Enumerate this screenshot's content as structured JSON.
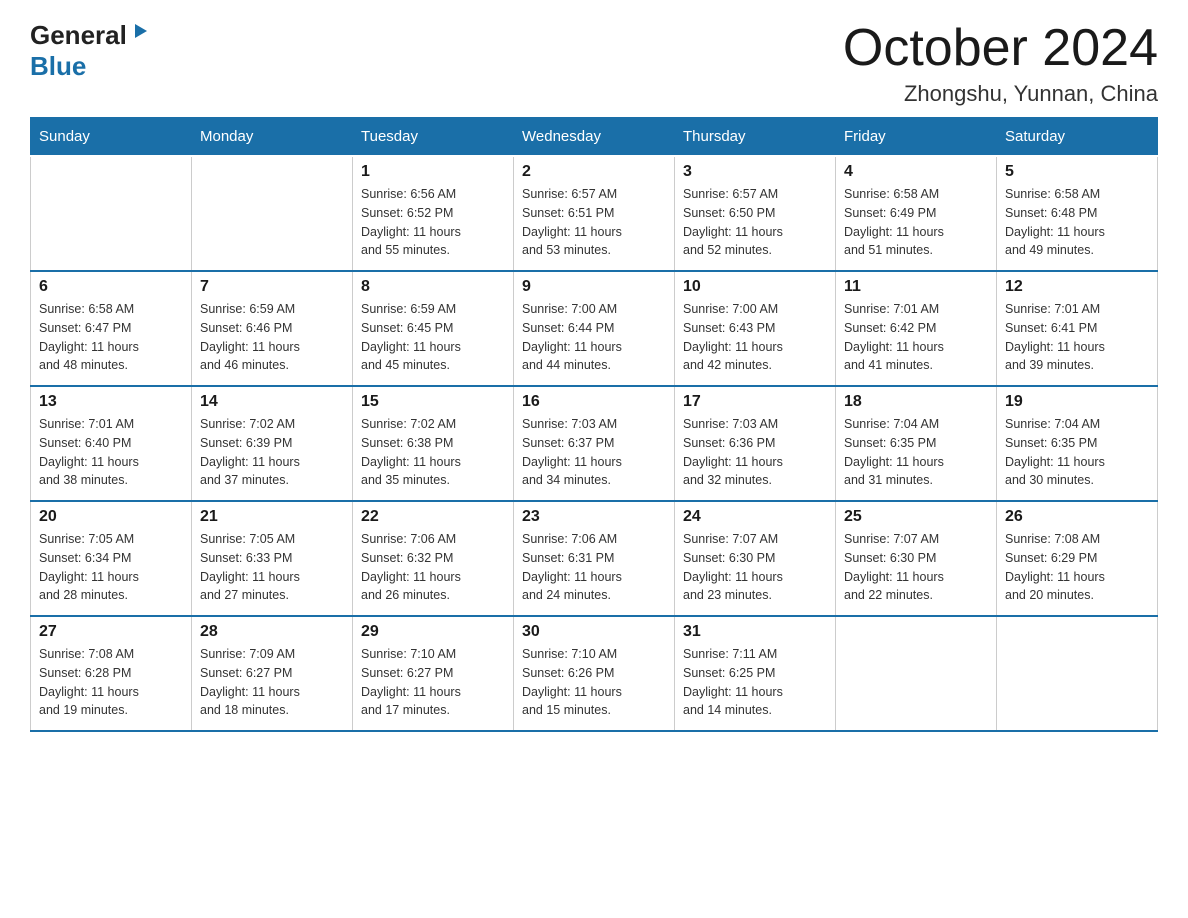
{
  "logo": {
    "general": "General",
    "blue": "Blue"
  },
  "title": {
    "month": "October 2024",
    "location": "Zhongshu, Yunnan, China"
  },
  "days_header": [
    "Sunday",
    "Monday",
    "Tuesday",
    "Wednesday",
    "Thursday",
    "Friday",
    "Saturday"
  ],
  "weeks": [
    [
      {
        "day": "",
        "info": ""
      },
      {
        "day": "",
        "info": ""
      },
      {
        "day": "1",
        "info": "Sunrise: 6:56 AM\nSunset: 6:52 PM\nDaylight: 11 hours\nand 55 minutes."
      },
      {
        "day": "2",
        "info": "Sunrise: 6:57 AM\nSunset: 6:51 PM\nDaylight: 11 hours\nand 53 minutes."
      },
      {
        "day": "3",
        "info": "Sunrise: 6:57 AM\nSunset: 6:50 PM\nDaylight: 11 hours\nand 52 minutes."
      },
      {
        "day": "4",
        "info": "Sunrise: 6:58 AM\nSunset: 6:49 PM\nDaylight: 11 hours\nand 51 minutes."
      },
      {
        "day": "5",
        "info": "Sunrise: 6:58 AM\nSunset: 6:48 PM\nDaylight: 11 hours\nand 49 minutes."
      }
    ],
    [
      {
        "day": "6",
        "info": "Sunrise: 6:58 AM\nSunset: 6:47 PM\nDaylight: 11 hours\nand 48 minutes."
      },
      {
        "day": "7",
        "info": "Sunrise: 6:59 AM\nSunset: 6:46 PM\nDaylight: 11 hours\nand 46 minutes."
      },
      {
        "day": "8",
        "info": "Sunrise: 6:59 AM\nSunset: 6:45 PM\nDaylight: 11 hours\nand 45 minutes."
      },
      {
        "day": "9",
        "info": "Sunrise: 7:00 AM\nSunset: 6:44 PM\nDaylight: 11 hours\nand 44 minutes."
      },
      {
        "day": "10",
        "info": "Sunrise: 7:00 AM\nSunset: 6:43 PM\nDaylight: 11 hours\nand 42 minutes."
      },
      {
        "day": "11",
        "info": "Sunrise: 7:01 AM\nSunset: 6:42 PM\nDaylight: 11 hours\nand 41 minutes."
      },
      {
        "day": "12",
        "info": "Sunrise: 7:01 AM\nSunset: 6:41 PM\nDaylight: 11 hours\nand 39 minutes."
      }
    ],
    [
      {
        "day": "13",
        "info": "Sunrise: 7:01 AM\nSunset: 6:40 PM\nDaylight: 11 hours\nand 38 minutes."
      },
      {
        "day": "14",
        "info": "Sunrise: 7:02 AM\nSunset: 6:39 PM\nDaylight: 11 hours\nand 37 minutes."
      },
      {
        "day": "15",
        "info": "Sunrise: 7:02 AM\nSunset: 6:38 PM\nDaylight: 11 hours\nand 35 minutes."
      },
      {
        "day": "16",
        "info": "Sunrise: 7:03 AM\nSunset: 6:37 PM\nDaylight: 11 hours\nand 34 minutes."
      },
      {
        "day": "17",
        "info": "Sunrise: 7:03 AM\nSunset: 6:36 PM\nDaylight: 11 hours\nand 32 minutes."
      },
      {
        "day": "18",
        "info": "Sunrise: 7:04 AM\nSunset: 6:35 PM\nDaylight: 11 hours\nand 31 minutes."
      },
      {
        "day": "19",
        "info": "Sunrise: 7:04 AM\nSunset: 6:35 PM\nDaylight: 11 hours\nand 30 minutes."
      }
    ],
    [
      {
        "day": "20",
        "info": "Sunrise: 7:05 AM\nSunset: 6:34 PM\nDaylight: 11 hours\nand 28 minutes."
      },
      {
        "day": "21",
        "info": "Sunrise: 7:05 AM\nSunset: 6:33 PM\nDaylight: 11 hours\nand 27 minutes."
      },
      {
        "day": "22",
        "info": "Sunrise: 7:06 AM\nSunset: 6:32 PM\nDaylight: 11 hours\nand 26 minutes."
      },
      {
        "day": "23",
        "info": "Sunrise: 7:06 AM\nSunset: 6:31 PM\nDaylight: 11 hours\nand 24 minutes."
      },
      {
        "day": "24",
        "info": "Sunrise: 7:07 AM\nSunset: 6:30 PM\nDaylight: 11 hours\nand 23 minutes."
      },
      {
        "day": "25",
        "info": "Sunrise: 7:07 AM\nSunset: 6:30 PM\nDaylight: 11 hours\nand 22 minutes."
      },
      {
        "day": "26",
        "info": "Sunrise: 7:08 AM\nSunset: 6:29 PM\nDaylight: 11 hours\nand 20 minutes."
      }
    ],
    [
      {
        "day": "27",
        "info": "Sunrise: 7:08 AM\nSunset: 6:28 PM\nDaylight: 11 hours\nand 19 minutes."
      },
      {
        "day": "28",
        "info": "Sunrise: 7:09 AM\nSunset: 6:27 PM\nDaylight: 11 hours\nand 18 minutes."
      },
      {
        "day": "29",
        "info": "Sunrise: 7:10 AM\nSunset: 6:27 PM\nDaylight: 11 hours\nand 17 minutes."
      },
      {
        "day": "30",
        "info": "Sunrise: 7:10 AM\nSunset: 6:26 PM\nDaylight: 11 hours\nand 15 minutes."
      },
      {
        "day": "31",
        "info": "Sunrise: 7:11 AM\nSunset: 6:25 PM\nDaylight: 11 hours\nand 14 minutes."
      },
      {
        "day": "",
        "info": ""
      },
      {
        "day": "",
        "info": ""
      }
    ]
  ]
}
